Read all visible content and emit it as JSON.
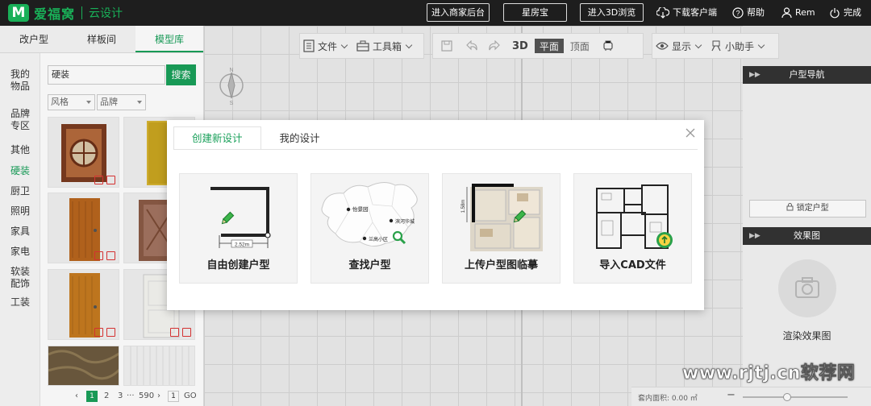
{
  "app": {
    "brand": "爱福窝",
    "product": "云设计"
  },
  "topbar": {
    "merchant_btn": "进入商家后台",
    "star_btn": "星房宝",
    "browse3d_btn": "进入3D浏览",
    "download": "下载客户端",
    "help": "帮助",
    "user": "Rem",
    "done": "完成"
  },
  "left": {
    "tabs": [
      "改户型",
      "样板间",
      "模型库"
    ],
    "categories": [
      "我的物品",
      "品牌专区",
      "其他",
      "硬装",
      "厨卫",
      "照明",
      "家具",
      "家电",
      "软装配饰",
      "工装"
    ],
    "search_value": "硬装",
    "search_btn": "搜索",
    "filter_style": "风格",
    "filter_brand": "品牌",
    "pager": {
      "p1": "1",
      "p2": "2",
      "p3": "3",
      "ellipsis": "···",
      "last": "590",
      "jump_value": "1",
      "go": "GO"
    }
  },
  "toolbar": {
    "file": "文件",
    "toolbox": "工具箱",
    "view3d": "3D",
    "plan": "平面",
    "top": "顶面",
    "display": "显示",
    "assistant": "小助手"
  },
  "right": {
    "nav_title": "户型导航",
    "lock_btn": "锁定户型",
    "effect_title": "效果图",
    "render_label": "渲染效果图"
  },
  "bottom": {
    "area_label": "套内面积: 0.00 ㎡"
  },
  "modal": {
    "tabs": [
      "创建新设计",
      "我的设计"
    ],
    "cards": [
      "自由创建户型",
      "查找户型",
      "上传户型图临摹",
      "导入CAD文件"
    ],
    "dimension_label": "2.52m",
    "dimension_label_vertical": "1.58m",
    "map_labels": [
      "怡景园",
      "滨河华城",
      "兰高小区"
    ]
  },
  "watermark": "www.rjtj.cn软荐网",
  "colors": {
    "brand_green": "#19a05a",
    "topbar_bg": "#1e1e1e"
  }
}
